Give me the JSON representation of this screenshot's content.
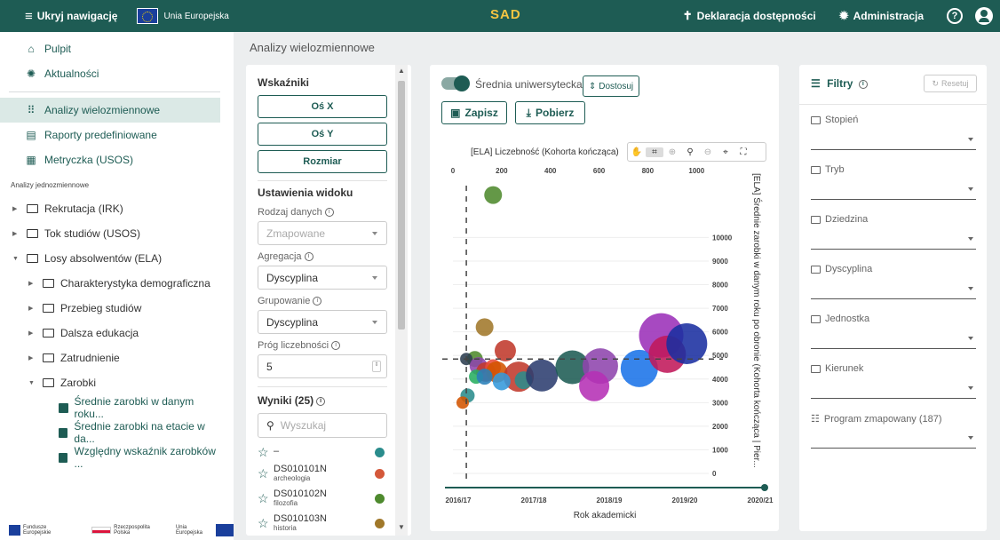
{
  "topbar": {
    "hide_nav": "Ukryj nawigację",
    "eu_label": "Unia Europejska",
    "logo": "SAD",
    "accessibility": "Deklaracja dostępności",
    "admin": "Administracja",
    "help": "?"
  },
  "sidebar": {
    "pulpit": "Pulpit",
    "news": "Aktualności",
    "analyses_multi": "Analizy wielozmiennowe",
    "predefined_reports": "Raporty predefiniowane",
    "metrics": "Metryczka (USOS)",
    "single_header": "Analizy jednozmiennowe",
    "tree": {
      "recruitment": "Rekrutacja (IRK)",
      "studies": "Tok studiów (USOS)",
      "graduates": "Losy absolwentów (ELA)",
      "demographics": "Charakterystyka demograficzna",
      "course": "Przebieg studiów",
      "further_edu": "Dalsza edukacja",
      "employment": "Zatrudnienie",
      "earnings": "Zarobki",
      "leaf1": "Średnie zarobki w danym roku...",
      "leaf2": "Średnie zarobki na etacie w da...",
      "leaf3": "Względny wskaźnik zarobków ..."
    },
    "footer": {
      "funds": "Fundusze Europejskie",
      "poland": "Rzeczpospolita Polska",
      "eu": "Unia Europejska"
    }
  },
  "page_title": "Analizy wielozmiennowe",
  "left_panel": {
    "indicators": "Wskaźniki",
    "axis_x": "Oś X",
    "axis_y": "Oś Y",
    "size": "Rozmiar",
    "view_settings": "Ustawienia widoku",
    "data_type_label": "Rodzaj danych",
    "data_type_value": "Zmapowane",
    "aggregation_label": "Agregacja",
    "aggregation_value": "Dyscyplina",
    "grouping_label": "Grupowanie",
    "grouping_value": "Dyscyplina",
    "threshold_label": "Próg liczebności",
    "threshold_value": "5",
    "results_label": "Wyniki (25)",
    "search_placeholder": "Wyszukaj",
    "results": [
      {
        "code": "–",
        "name": "",
        "color": "#2a8c8c"
      },
      {
        "code": "DS010101N",
        "name": "archeologia",
        "color": "#d4583a"
      },
      {
        "code": "DS010102N",
        "name": "filozofia",
        "color": "#4e8a2e"
      },
      {
        "code": "DS010103N",
        "name": "historia",
        "color": "#a0782a"
      }
    ]
  },
  "chart_panel": {
    "toggle_label": "Średnia uniwersytecka",
    "adjust": "Dostosuj",
    "save": "Zapisz",
    "download": "Pobierz"
  },
  "chart_data": {
    "type": "scatter",
    "title": "[ELA] Liczebność (Kohorta kończąca)",
    "ylabel": "[ELA] Średnie zarobki w danym roku po obronie (Kohorta kończąca | Pier...",
    "slider_label": "Rok akademicki",
    "slider_ticks": [
      "2016/17",
      "2017/18",
      "2018/19",
      "2019/20",
      "2020/21"
    ],
    "x_ticks": [
      0,
      200,
      400,
      600,
      800,
      1000
    ],
    "y_ticks": [
      0,
      1000,
      2000,
      3000,
      4000,
      5000,
      6000,
      7000,
      8000,
      9000,
      10000
    ],
    "xlim": [
      0,
      1050
    ],
    "ylim": [
      -300,
      12500
    ],
    "average": {
      "x": 55,
      "y": 4850
    },
    "points": [
      {
        "x": 165,
        "y": 11800,
        "r": 10,
        "color": "#4e8a2e"
      },
      {
        "x": 130,
        "y": 6200,
        "r": 10,
        "color": "#a0782a"
      },
      {
        "x": 215,
        "y": 5200,
        "r": 12,
        "color": "#c0392b"
      },
      {
        "x": 90,
        "y": 4850,
        "r": 9,
        "color": "#4e8a2e"
      },
      {
        "x": 55,
        "y": 4850,
        "r": 7,
        "color": "#2c3e50"
      },
      {
        "x": 105,
        "y": 4550,
        "r": 10,
        "color": "#8e44ad"
      },
      {
        "x": 135,
        "y": 4300,
        "r": 11,
        "color": "#c0392b"
      },
      {
        "x": 165,
        "y": 4500,
        "r": 9,
        "color": "#e74c3c"
      },
      {
        "x": 180,
        "y": 4300,
        "r": 12,
        "color": "#d35400"
      },
      {
        "x": 95,
        "y": 4100,
        "r": 8,
        "color": "#27ae60"
      },
      {
        "x": 130,
        "y": 4100,
        "r": 9,
        "color": "#2980b9"
      },
      {
        "x": 270,
        "y": 4100,
        "r": 17,
        "color": "#c0392b"
      },
      {
        "x": 200,
        "y": 3900,
        "r": 10,
        "color": "#3498db"
      },
      {
        "x": 290,
        "y": 3950,
        "r": 10,
        "color": "#2a8c8c"
      },
      {
        "x": 365,
        "y": 4150,
        "r": 18,
        "color": "#2c3e70"
      },
      {
        "x": 490,
        "y": 4500,
        "r": 19,
        "color": "#1e5c54"
      },
      {
        "x": 605,
        "y": 4550,
        "r": 20,
        "color": "#8e44ad"
      },
      {
        "x": 580,
        "y": 3700,
        "r": 17,
        "color": "#b530b5"
      },
      {
        "x": 765,
        "y": 4450,
        "r": 21,
        "color": "#1a73e8"
      },
      {
        "x": 855,
        "y": 5850,
        "r": 25,
        "color": "#9b30b8"
      },
      {
        "x": 880,
        "y": 5050,
        "r": 21,
        "color": "#c0185a"
      },
      {
        "x": 960,
        "y": 5500,
        "r": 23,
        "color": "#1a2fa0"
      },
      {
        "x": 60,
        "y": 3300,
        "r": 8,
        "color": "#2a8c8c"
      },
      {
        "x": 40,
        "y": 3000,
        "r": 7,
        "color": "#d35400"
      }
    ]
  },
  "filters": {
    "title": "Filtry",
    "reset": "Resetuj",
    "items": [
      "Stopień",
      "Tryb",
      "Dziedzina",
      "Dyscyplina",
      "Jednostka",
      "Kierunek",
      "Program zmapowany (187)"
    ]
  }
}
